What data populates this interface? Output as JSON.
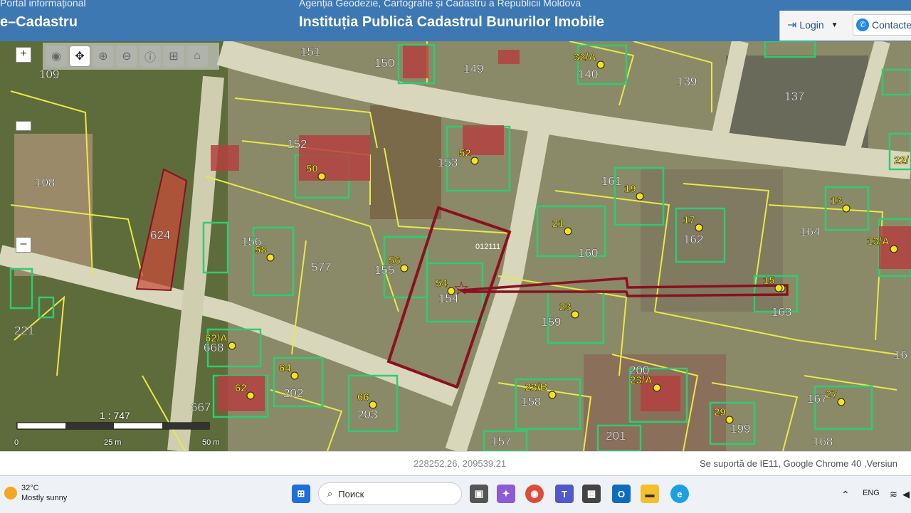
{
  "header": {
    "portal_sub": "Portal informațional",
    "portal_title": "e–Cadastru",
    "agency": "Agenția Geodezie, Cartografie și Cadastru a Republicii Moldova",
    "institution": "Instituția Publică Cadastrul Bunurilor Imobile",
    "login_label": "Login",
    "contacte_label": "Contacte"
  },
  "toolbar": {
    "tools": [
      "globe-icon",
      "pan-icon",
      "zoom-in-icon",
      "zoom-out-icon",
      "info-icon",
      "measure-icon",
      "home-icon"
    ],
    "zoom_in": "+",
    "zoom_out": "–"
  },
  "map": {
    "parcel_labels": [
      {
        "t": "151"
      },
      {
        "t": "150"
      },
      {
        "t": "149"
      },
      {
        "t": "109"
      },
      {
        "t": "140"
      },
      {
        "t": "139"
      },
      {
        "t": "137"
      },
      {
        "t": "152"
      },
      {
        "t": "153"
      },
      {
        "t": "108"
      },
      {
        "t": "161"
      },
      {
        "t": "624"
      },
      {
        "t": "156"
      },
      {
        "t": "577"
      },
      {
        "t": "155"
      },
      {
        "t": "154"
      },
      {
        "t": "160"
      },
      {
        "t": "162"
      },
      {
        "t": "164"
      },
      {
        "t": "163"
      },
      {
        "t": "159"
      },
      {
        "t": "221"
      },
      {
        "t": "668"
      },
      {
        "t": "202"
      },
      {
        "t": "667"
      },
      {
        "t": "203"
      },
      {
        "t": "158"
      },
      {
        "t": "200"
      },
      {
        "t": "167"
      },
      {
        "t": "199"
      },
      {
        "t": "157"
      },
      {
        "t": "201"
      },
      {
        "t": "168"
      },
      {
        "t": "16"
      }
    ],
    "address_labels": [
      {
        "t": "32/A"
      },
      {
        "t": "52"
      },
      {
        "t": "50"
      },
      {
        "t": "19"
      },
      {
        "t": "21"
      },
      {
        "t": "17"
      },
      {
        "t": "13"
      },
      {
        "t": "13/A"
      },
      {
        "t": "58"
      },
      {
        "t": "56"
      },
      {
        "t": "54"
      },
      {
        "t": "15"
      },
      {
        "t": "23"
      },
      {
        "t": "62/A"
      },
      {
        "t": "64"
      },
      {
        "t": "62"
      },
      {
        "t": "66"
      },
      {
        "t": "23/B"
      },
      {
        "t": "23/A"
      },
      {
        "t": "27"
      },
      {
        "t": "29"
      },
      {
        "t": "22/"
      }
    ],
    "cadastral_code": "012111",
    "scale_label": "1 : 747",
    "scale_ticks": [
      "0",
      "25 m",
      "50 m"
    ]
  },
  "status": {
    "coordinates": "228252.26, 209539.21",
    "browser_support": "Se suportă de IE11, Google Chrome 40 ,Versiun"
  },
  "taskbar": {
    "temperature": "32°C",
    "weather": "Mostly sunny",
    "search_label": "Поиск",
    "language": "ENG"
  },
  "colors": {
    "header": "#3d78b3",
    "parcel": "#e8e84a",
    "building": "#2ecc71",
    "selected": "#8b1020",
    "highlight": "#cc4a3a"
  }
}
